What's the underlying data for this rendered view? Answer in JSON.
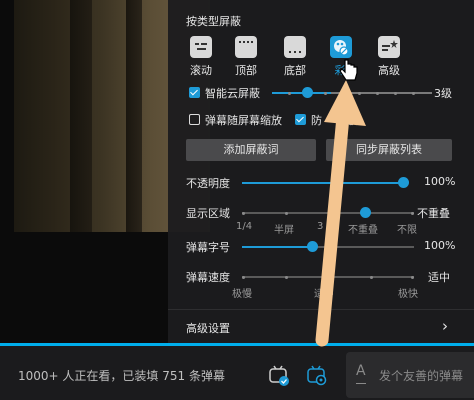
{
  "panel": {
    "section_title": "按类型屏蔽",
    "types": [
      {
        "label": "滚动",
        "icon": "scroll-danmaku-icon"
      },
      {
        "label": "顶部",
        "icon": "top-danmaku-icon"
      },
      {
        "label": "底部",
        "icon": "bottom-danmaku-icon"
      },
      {
        "label": "彩",
        "icon": "color-danmaku-icon",
        "active": true
      },
      {
        "label": "高级",
        "icon": "advanced-danmaku-icon"
      }
    ],
    "smart_cloud": {
      "label": "智能云屏蔽",
      "level": "3级",
      "value_fraction": 0.37,
      "checked": true
    },
    "follow_scale": {
      "label": "弹幕随屏幕缩放",
      "checked": false
    },
    "anti_block": {
      "label": "防",
      "suffix": "蔽",
      "checked": true
    },
    "add_button": "添加屏蔽词",
    "sync_button": "同步屏蔽列表",
    "opacity": {
      "label": "不透明度",
      "value": "100%",
      "fraction": 1.0
    },
    "display_area": {
      "label": "显示区域",
      "value": "不重叠",
      "ticks": [
        "1/4",
        "半屏",
        "3",
        "不重叠",
        "不限"
      ],
      "fraction": 0.75
    },
    "font_size": {
      "label": "弹幕字号",
      "value": "100%",
      "fraction": 0.42
    },
    "speed": {
      "label": "弹幕速度",
      "value": "适中",
      "ticks": [
        "极慢",
        "适中",
        "极快"
      ],
      "fraction": 0.5
    },
    "advanced": {
      "label": "高级设置",
      "arrow": "›"
    }
  },
  "bottom": {
    "viewers": "1000+ 人正在看，已装填 751 条弹幕",
    "danmaku_toggle_icon": "danmaku-toggle-icon",
    "danmaku_settings_icon": "danmaku-settings-icon",
    "input_prefix": "A",
    "input_placeholder": "发个友善的弹幕"
  },
  "colors": {
    "accent": "#1e9bd7",
    "progress": "#00aeec",
    "arrow": "#f4c590"
  }
}
